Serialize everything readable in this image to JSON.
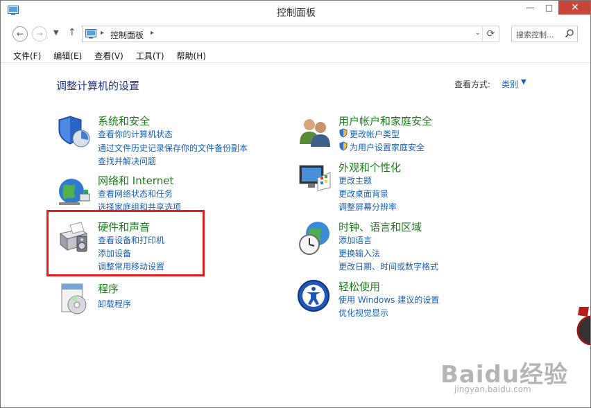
{
  "window": {
    "title": "控制面板",
    "caption": {
      "minimize": "—",
      "maximize": "□",
      "close": "✕"
    }
  },
  "nav": {
    "back_icon": "back-arrow-icon",
    "forward_icon": "forward-arrow-icon",
    "up_icon": "up-arrow-icon",
    "breadcrumb": "控制面板",
    "search_placeholder": "搜索控制..."
  },
  "menu": [
    "文件(F)",
    "编辑(E)",
    "查看(V)",
    "工具(T)",
    "帮助(H)"
  ],
  "content": {
    "heading": "调整计算机的设置",
    "view_by_label": "查看方式:",
    "view_by_value": "类别"
  },
  "categories": {
    "system": {
      "title": "系统和安全",
      "links": [
        "查看你的计算机状态",
        "通过文件历史记录保存你的文件备份副本",
        "查找并解决问题"
      ]
    },
    "network": {
      "title": "网络和 Internet",
      "links": [
        "查看网络状态和任务",
        "选择家庭组和共享选项"
      ]
    },
    "hardware": {
      "title": "硬件和声音",
      "links": [
        "查看设备和打印机",
        "添加设备",
        "调整常用移动设置"
      ]
    },
    "programs": {
      "title": "程序",
      "links": [
        "卸载程序"
      ]
    },
    "accounts": {
      "title": "用户帐户和家庭安全",
      "links": [
        "更改帐户类型",
        "为用户设置家庭安全"
      ]
    },
    "appearance": {
      "title": "外观和个性化",
      "links": [
        "更改主题",
        "更改桌面背景",
        "调整屏幕分辨率"
      ]
    },
    "clock": {
      "title": "时钟、语言和区域",
      "links": [
        "添加语言",
        "更换输入法",
        "更改日期、时间或数字格式"
      ]
    },
    "ease": {
      "title": "轻松使用",
      "links": [
        "使用 Windows 建议的设置",
        "优化视觉显示"
      ]
    }
  },
  "colors": {
    "category_title": "#1b7d1b",
    "link": "#1a5fb4",
    "heading": "#1e3287",
    "highlight": "#e11d1d",
    "close_button": "#c7463a"
  },
  "watermark": {
    "brand": "Baidu经验",
    "url": "jingyan.baidu.com"
  }
}
